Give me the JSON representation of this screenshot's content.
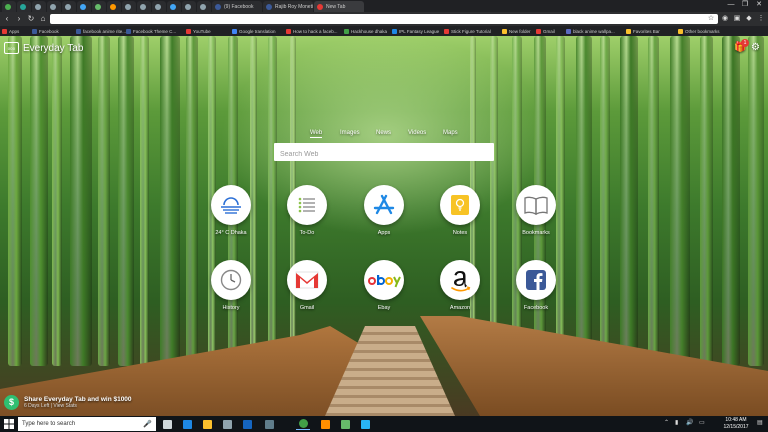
{
  "browser": {
    "tabs": [
      {
        "title": "",
        "color": "#4caf50"
      },
      {
        "title": "",
        "color": "#26a69a"
      },
      {
        "title": "",
        "color": "#90a4ae"
      },
      {
        "title": "",
        "color": "#90a4ae"
      },
      {
        "title": "",
        "color": "#90a4ae"
      },
      {
        "title": "",
        "color": "#42a5f5"
      },
      {
        "title": "",
        "color": "#66bb6a"
      },
      {
        "title": "",
        "color": "#ff9800"
      },
      {
        "title": "",
        "color": "#90a4ae"
      },
      {
        "title": "",
        "color": "#90a4ae"
      },
      {
        "title": "",
        "color": "#90a4ae"
      },
      {
        "title": "",
        "color": "#42a5f5"
      },
      {
        "title": "",
        "color": "#90a4ae"
      },
      {
        "title": "",
        "color": "#90a4ae"
      },
      {
        "title": "(9) Facebook",
        "color": "#3b5998"
      },
      {
        "title": "Rajib Roy Monetize 15/1/2...",
        "color": "#3b5998"
      },
      {
        "title": "New Tab",
        "color": "#e53935",
        "active": true
      }
    ],
    "window_controls": [
      "—",
      "❐",
      "✕"
    ],
    "omnibox": {
      "value": "",
      "placeholder": ""
    }
  },
  "bookmarks": [
    {
      "label": "Apps",
      "color": "#e53935"
    },
    {
      "label": "Facebook",
      "color": "#3b5998"
    },
    {
      "label": "facebook anime rite...",
      "color": "#3b5998"
    },
    {
      "label": "Facebook Theme C...",
      "color": "#3b5998"
    },
    {
      "label": "YouTube",
      "color": "#e53935"
    },
    {
      "label": "Google translation",
      "color": "#4285f4"
    },
    {
      "label": "How to hack a faceb...",
      "color": "#e53935"
    },
    {
      "label": "Hackhouse dhaka",
      "color": "#43a047"
    },
    {
      "label": "IPL Fantasy League",
      "color": "#1e88e5"
    },
    {
      "label": "Stick Figure Tutorial",
      "color": "#e53935"
    },
    {
      "label": "New folder",
      "color": "#fbc02d"
    },
    {
      "label": "Gmail",
      "color": "#e53935"
    },
    {
      "label": "black anime wallpa...",
      "color": "#5c6bc0"
    },
    {
      "label": "Favorites Bar",
      "color": "#fbc02d"
    },
    {
      "label": "Other bookmarks",
      "color": "#fbc02d"
    }
  ],
  "app": {
    "logo_glyph": "000",
    "name": "Everyday Tab",
    "notification_count": "1"
  },
  "search": {
    "tabs": [
      "Web",
      "Images",
      "News",
      "Videos",
      "Maps"
    ],
    "active_tab": "Web",
    "placeholder": "Search Web"
  },
  "shortcuts": [
    {
      "label": "24° C Dhaka",
      "icon": "weather-icon"
    },
    {
      "label": "To-Do",
      "icon": "todo-icon"
    },
    {
      "label": "Apps",
      "icon": "app-store-icon"
    },
    {
      "label": "Notes",
      "icon": "notes-icon"
    },
    {
      "label": "Bookmarks",
      "icon": "book-icon"
    },
    {
      "label": "History",
      "icon": "clock-icon"
    },
    {
      "label": "Gmail",
      "icon": "gmail-icon"
    },
    {
      "label": "Ebay",
      "icon": "ebay-icon"
    },
    {
      "label": "Amazon",
      "icon": "amazon-icon"
    },
    {
      "label": "Facebook",
      "icon": "facebook-icon"
    }
  ],
  "promo": {
    "title": "Share Everyday Tab and win $1000",
    "subtitle": "6 Days Left | View Stats"
  },
  "taskbar": {
    "search_placeholder": "Type here to search",
    "apps": [
      {
        "name": "task-view",
        "color": "#cfd8dc"
      },
      {
        "name": "edge",
        "color": "#1e88e5"
      },
      {
        "name": "file-explorer",
        "color": "#fbc02d"
      },
      {
        "name": "store",
        "color": "#90a4ae"
      },
      {
        "name": "mail",
        "color": "#1565c0"
      },
      {
        "name": "camera",
        "color": "#607d8b"
      },
      {
        "name": "chrome",
        "color": "#43a047",
        "open": true
      },
      {
        "name": "vlc",
        "color": "#ff8f00"
      },
      {
        "name": "torrent",
        "color": "#66bb6a"
      },
      {
        "name": "app-blue",
        "color": "#29b6f6"
      }
    ],
    "clock": {
      "time": "10:48 AM",
      "date": "12/15/2017"
    }
  }
}
